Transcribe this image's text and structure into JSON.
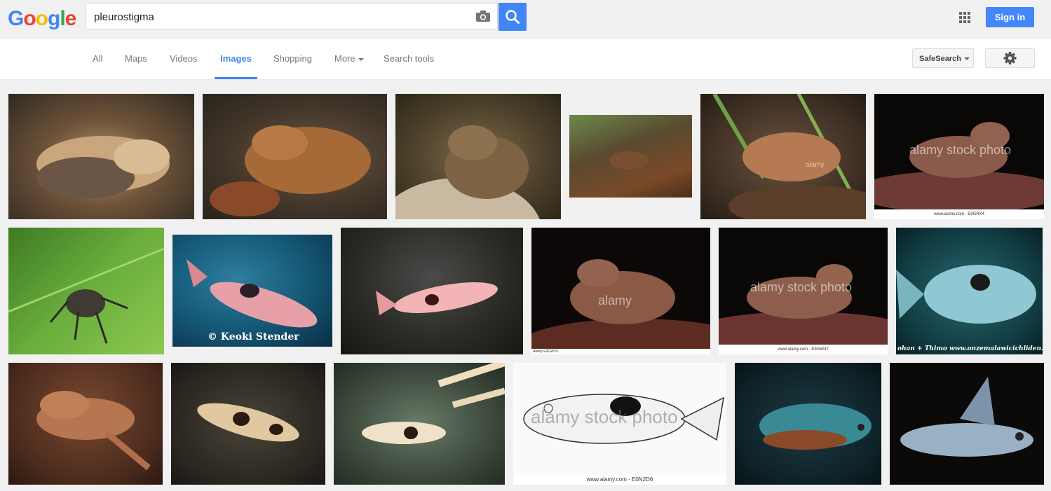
{
  "logo": {
    "letters": [
      "G",
      "o",
      "o",
      "g",
      "l",
      "e"
    ],
    "colors": [
      "#4285f4",
      "#ea4335",
      "#fbbc05",
      "#4285f4",
      "#34a853",
      "#ea4335"
    ]
  },
  "search": {
    "value": "pleurostigma"
  },
  "header": {
    "signin_label": "Sign in",
    "apps_icon": "apps-grid-icon"
  },
  "nav": {
    "tabs": [
      {
        "label": "All"
      },
      {
        "label": "Maps"
      },
      {
        "label": "Videos"
      },
      {
        "label": "Images",
        "active": true
      },
      {
        "label": "Shopping"
      },
      {
        "label": "More"
      },
      {
        "label": "Search tools"
      }
    ],
    "safesearch_label": "SafeSearch",
    "settings_icon": "gear-icon"
  },
  "results": {
    "watermarks": {
      "alamy": "alamy",
      "alamy_stock": "alamy stock photo",
      "keoki": "© Keoki Stender",
      "malawi": "ohan + Thimo    www.onzemalawicichliden.eu"
    },
    "captions": {
      "c1": "www.alamy.com - E9GRX4",
      "c2": "www.alamy.com - E9GW47",
      "c3": "www.alamy.com - E0N2D6",
      "c4": "Alamy E9GW3X"
    }
  },
  "colors": {
    "accent": "#4285f4",
    "signin": "#4387fd"
  }
}
